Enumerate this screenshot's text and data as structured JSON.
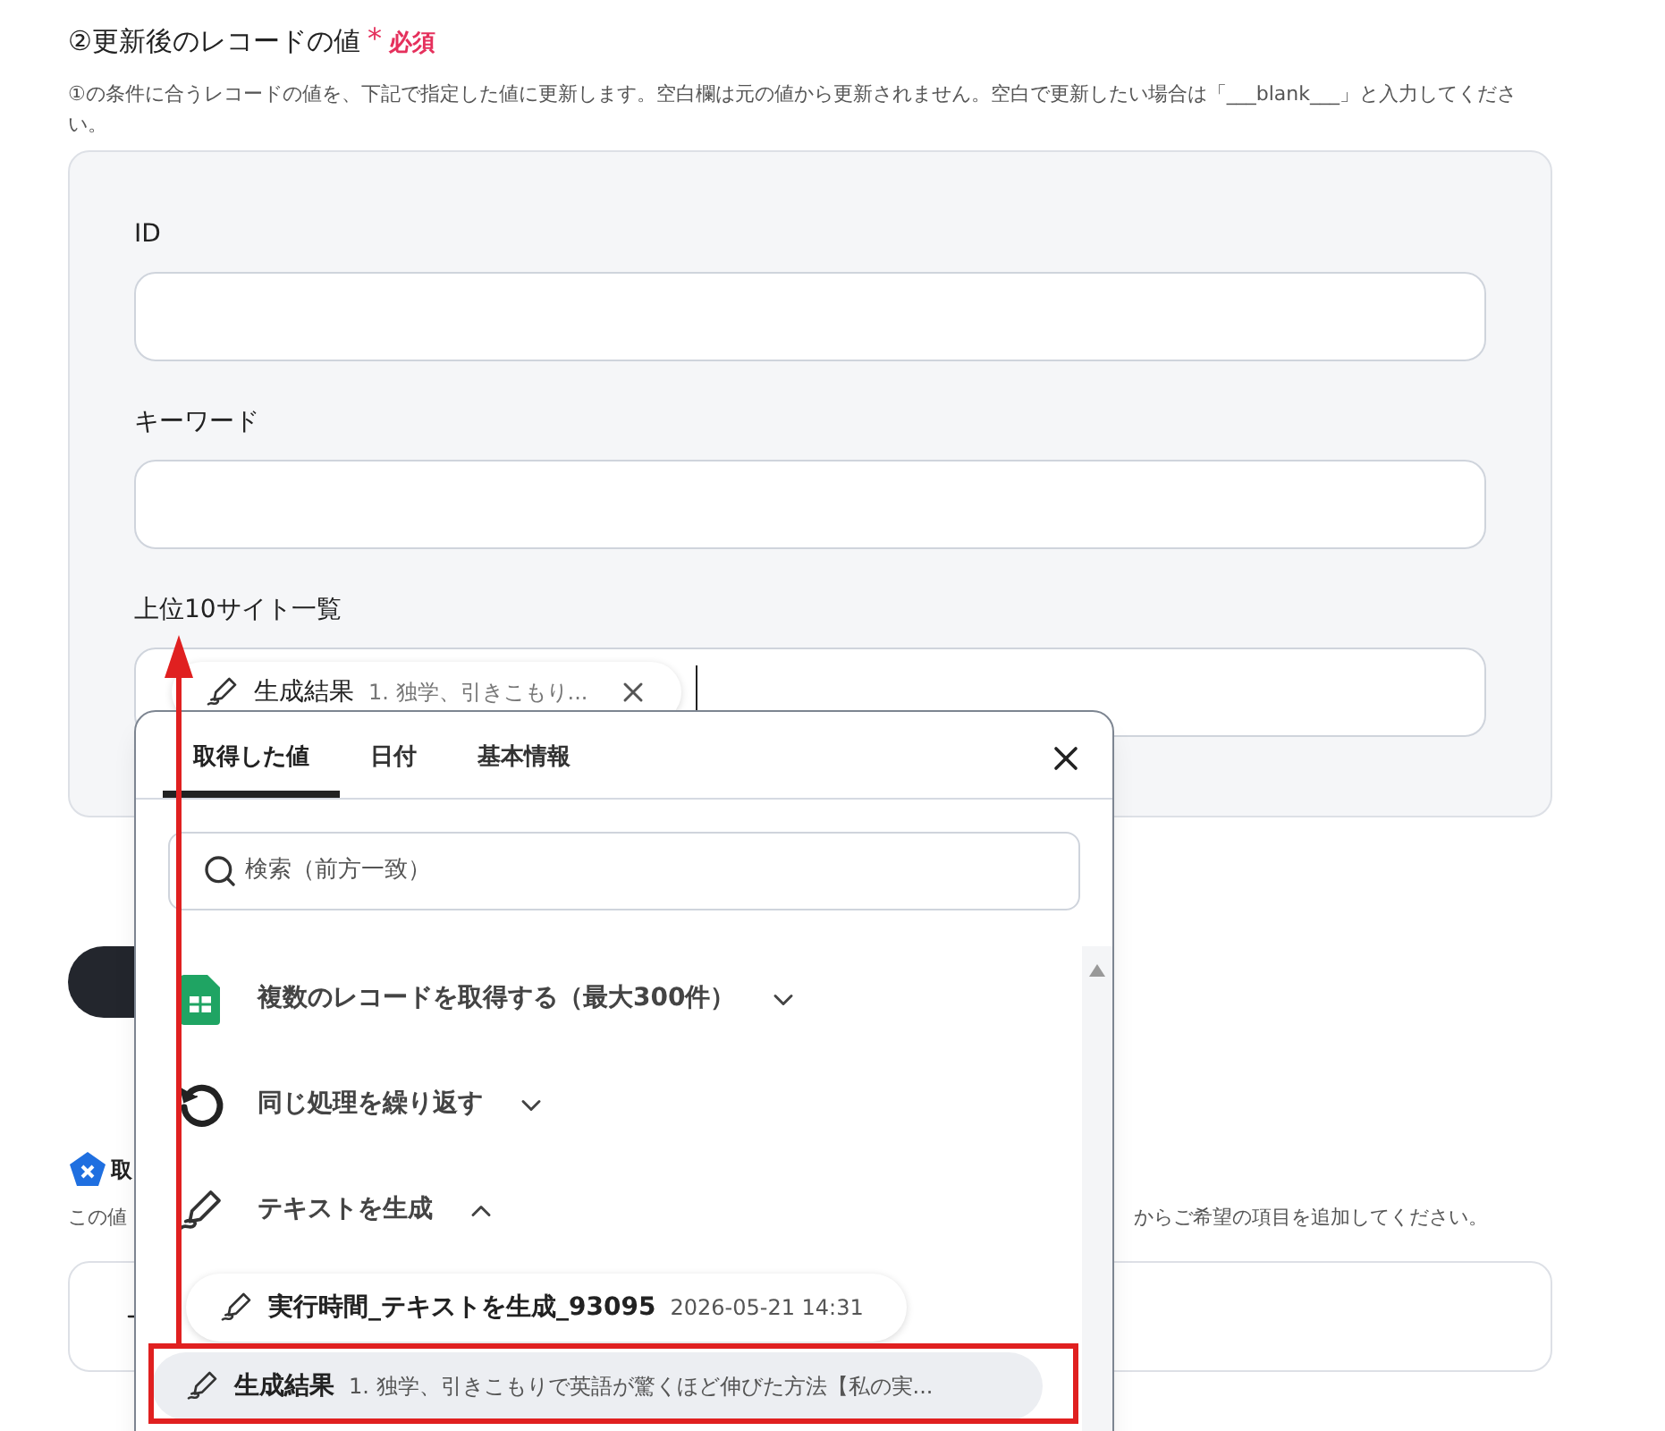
{
  "section": {
    "title": "②更新後のレコードの値",
    "required_mark": "*",
    "required_label": "必須",
    "description": "①の条件に合うレコードの値を、下記で指定した値に更新します。空白欄は元の値から更新されません。空白で更新したい場合は「___blank___」と入力してください。"
  },
  "fields": [
    {
      "label": "ID"
    },
    {
      "label": "キーワード"
    }
  ],
  "token_field": {
    "label": "上位10サイト一覧",
    "token": {
      "name": "生成結果",
      "preview": "1. 独学、引きこもり..."
    }
  },
  "next_section": {
    "title": "取",
    "description_left": "この値",
    "description_right": "からご希望の項目を追加してください。"
  },
  "popup": {
    "tabs": [
      {
        "label": "取得した値",
        "selected": true
      },
      {
        "label": "日付",
        "selected": false
      },
      {
        "label": "基本情報",
        "selected": false
      }
    ],
    "search": {
      "placeholder": "検索（前方一致）"
    },
    "groups": [
      {
        "kind": "sheets",
        "title": "複数のレコードを取得する（最大300件）",
        "expanded": false
      },
      {
        "kind": "loop",
        "title": "同じ処理を繰り返す",
        "expanded": false
      },
      {
        "kind": "text",
        "title": "テキストを生成",
        "expanded": true
      }
    ],
    "items": [
      {
        "name": "実行時間_テキストを生成_93095",
        "detail": "2026-05-21 14:31",
        "selected": false
      },
      {
        "name": "生成結果",
        "detail": "1. 独学、引きこもりで英語が驚くほど伸びた方法【私の実...",
        "selected": true
      }
    ]
  }
}
